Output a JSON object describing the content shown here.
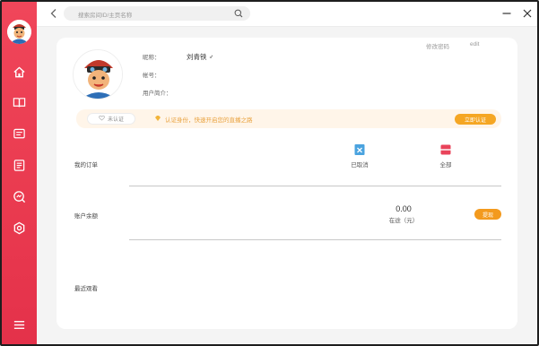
{
  "search": {
    "placeholder": "搜索房间ID/主页名称"
  },
  "profile": {
    "nickname_label": "昵称：",
    "nickname_value": "刘青铁 ♂",
    "account_label": "帐号：",
    "intro_label": "用户简介：",
    "edit_password": "修改密码",
    "edit": "edit"
  },
  "verification": {
    "status": "未认证",
    "message": "认证身份，快速开启您的直播之路",
    "button": "立即认证"
  },
  "orders": {
    "title": "我的订单",
    "items": [
      {
        "label": "已取消",
        "icon": "cancelled-order-icon"
      },
      {
        "label": "全部",
        "icon": "all-orders-icon"
      }
    ]
  },
  "balance": {
    "title": "账户余额",
    "amount": "0.00",
    "unit_label": "在途（元）",
    "withdraw": "提现"
  },
  "recent": {
    "title": "最近观看"
  },
  "colors": {
    "sidebar": "#ea3b50",
    "accent": "#f5a623",
    "verify_bg": "#fff5e9"
  }
}
